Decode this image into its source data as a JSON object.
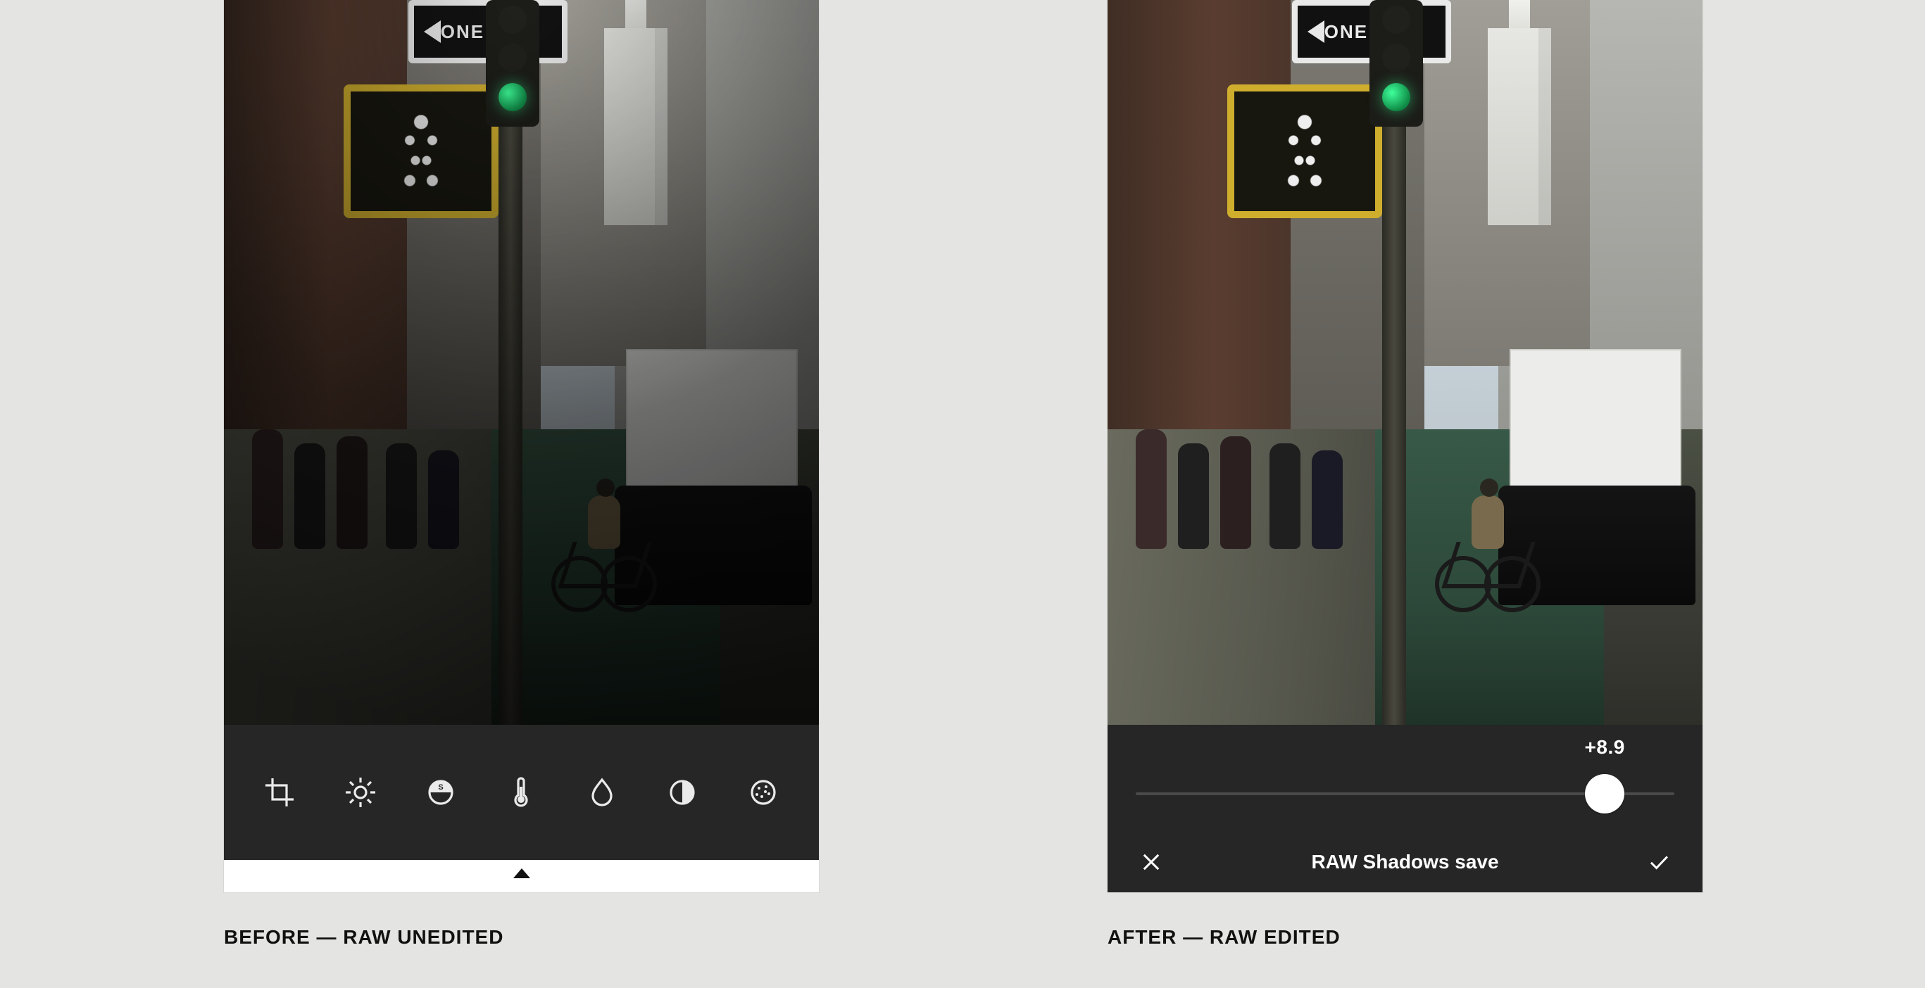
{
  "captions": {
    "before": "BEFORE — RAW UNEDITED",
    "after": "AFTER — RAW EDITED"
  },
  "scene": {
    "oneway_sign": "ONE WAY"
  },
  "before": {
    "tools": [
      {
        "name": "crop"
      },
      {
        "name": "exposure"
      },
      {
        "name": "shadows"
      },
      {
        "name": "temperature"
      },
      {
        "name": "tint"
      },
      {
        "name": "contrast"
      },
      {
        "name": "grain"
      }
    ]
  },
  "after": {
    "slider": {
      "title": "RAW Shadows save",
      "value_label": "+8.9",
      "value": 8.9,
      "min": -12,
      "max": 12
    },
    "actions": {
      "cancel_name": "cancel",
      "confirm_name": "confirm"
    }
  }
}
